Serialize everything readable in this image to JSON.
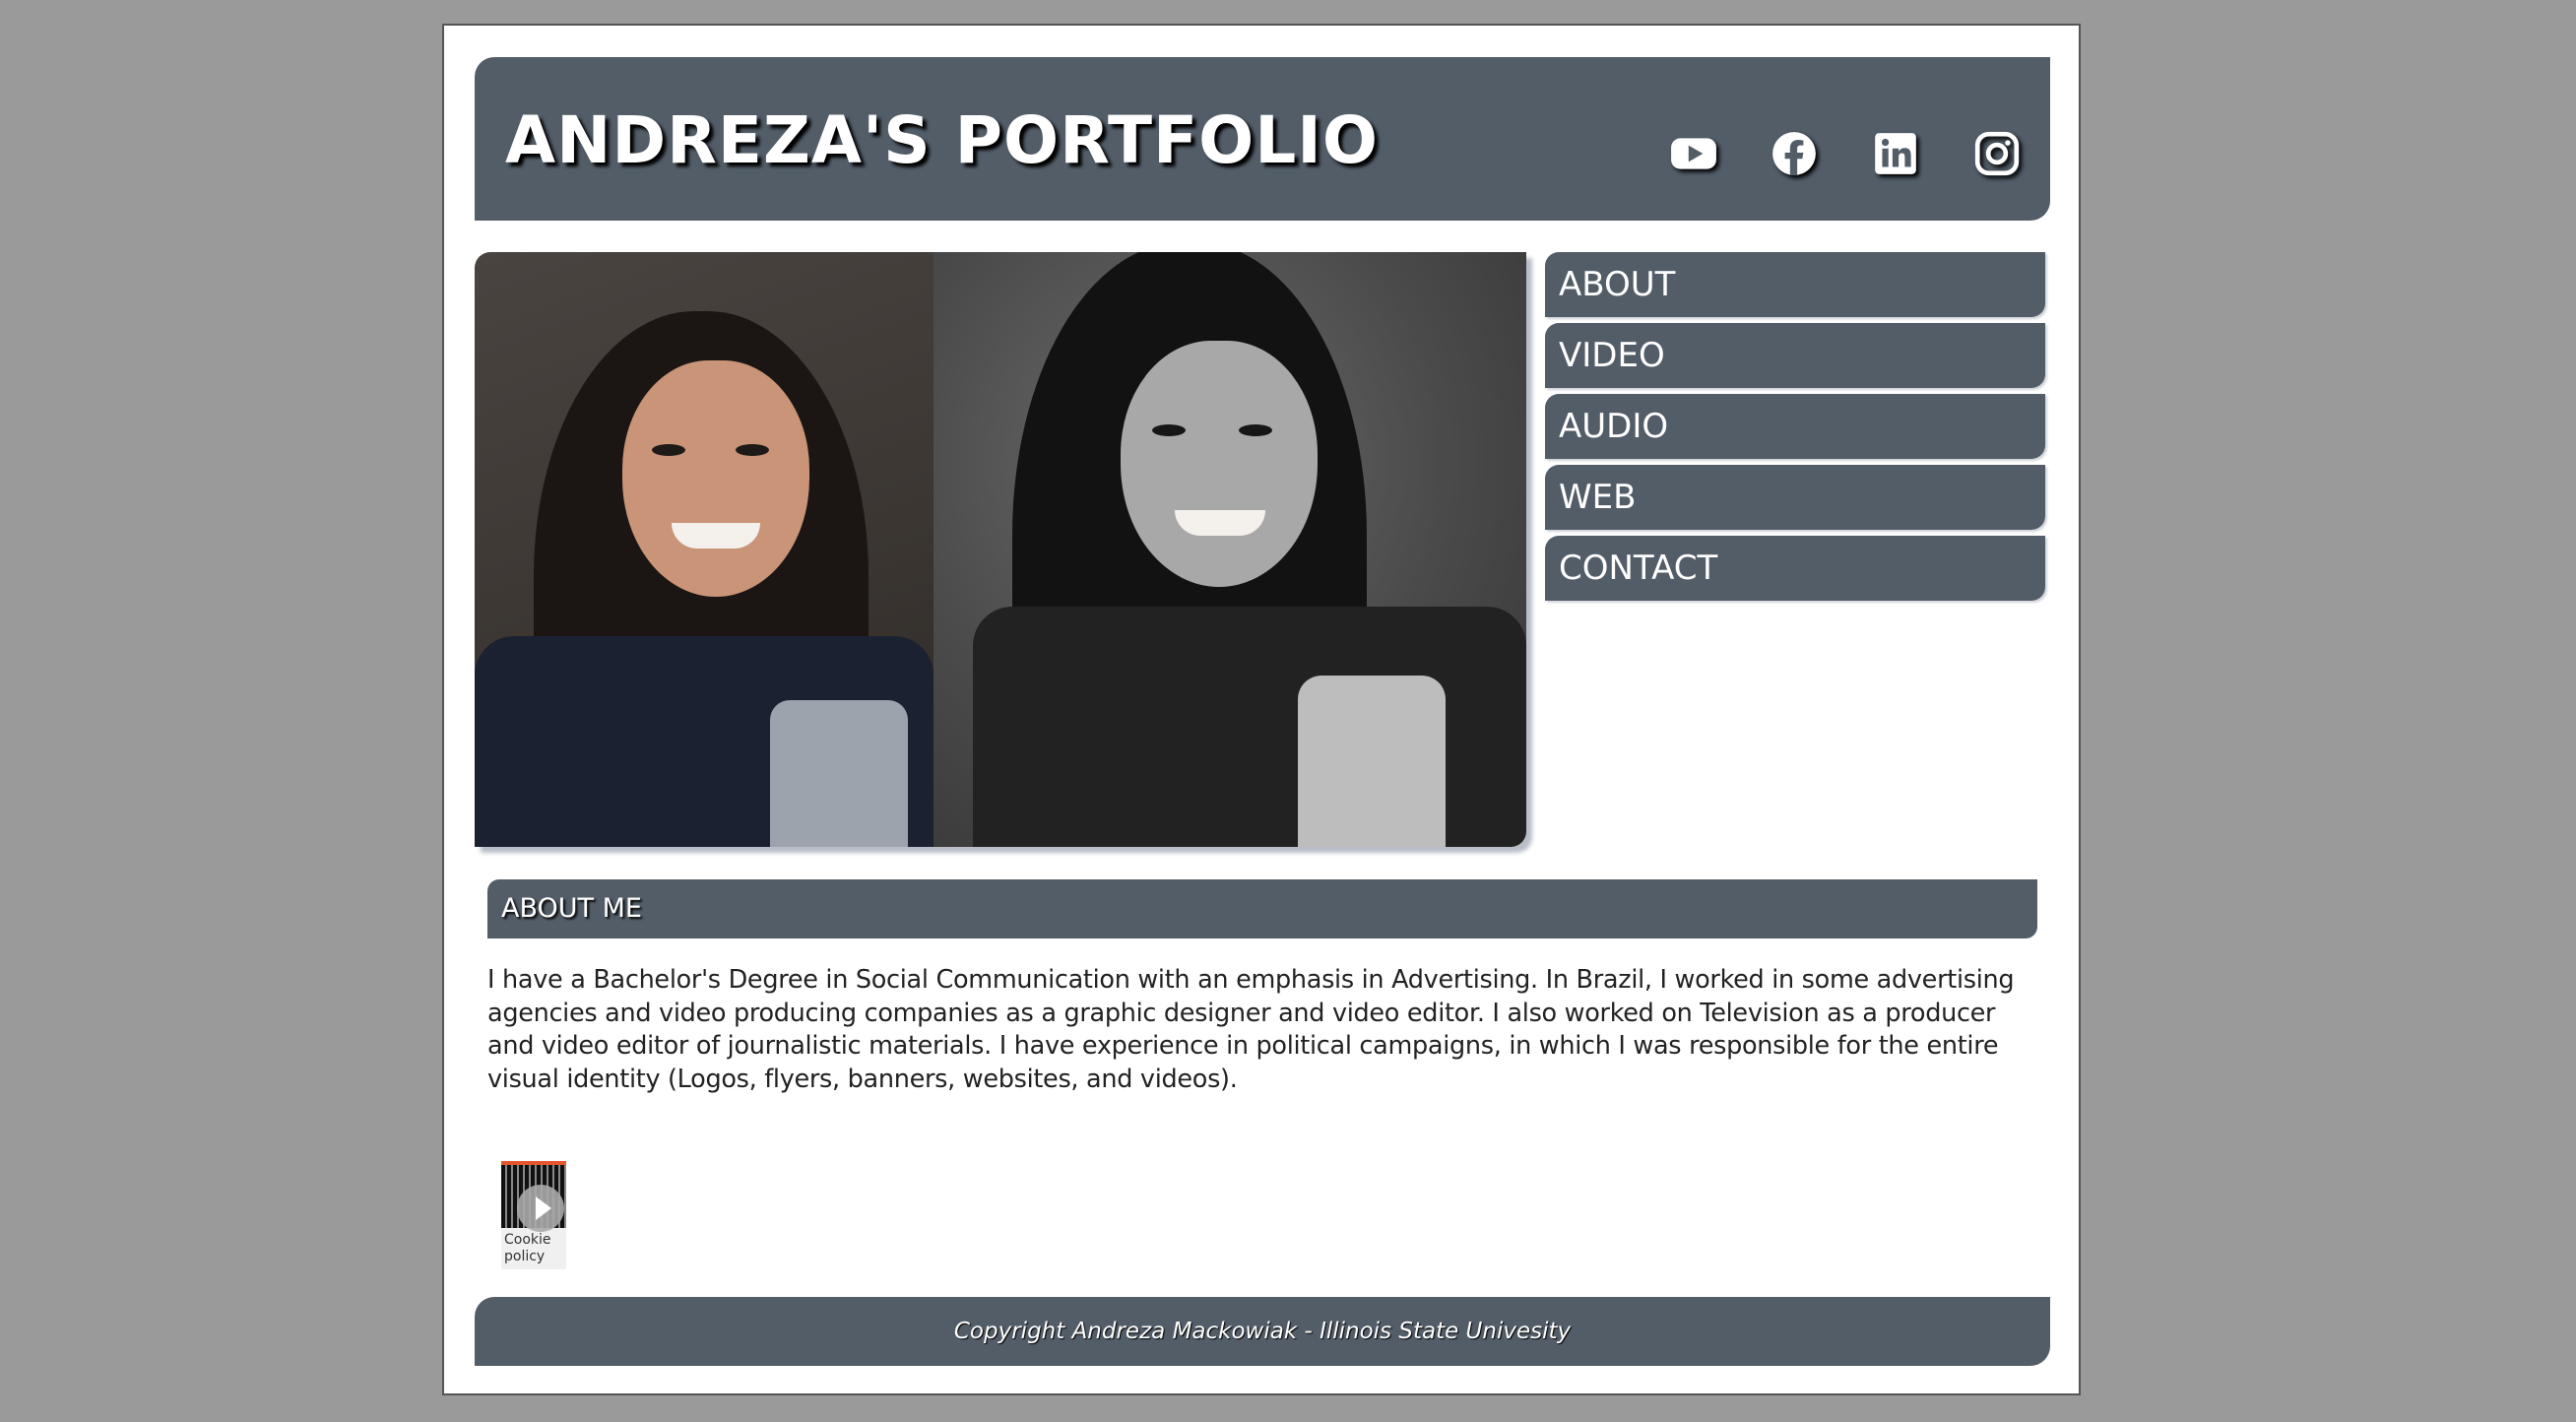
{
  "header": {
    "title": "ANDREZA'S PORTFOLIO",
    "social_icons": [
      "youtube-icon",
      "facebook-icon",
      "linkedin-icon",
      "instagram-icon"
    ]
  },
  "nav": {
    "items": [
      {
        "label": "ABOUT"
      },
      {
        "label": "VIDEO"
      },
      {
        "label": "AUDIO"
      },
      {
        "label": "WEB"
      },
      {
        "label": "CONTACT"
      }
    ]
  },
  "about": {
    "heading": "ABOUT ME",
    "body": "I have a Bachelor's Degree in Social Communication with an emphasis in Advertising. In Brazil, I worked in some advertising agencies and video producing companies as a graphic designer and video editor. I also worked on Television as a producer and video editor of journalistic materials. I have experience in political campaigns, in which I was responsible for the entire visual identity (Logos, flyers, banners, websites, and videos)."
  },
  "cookie_badge": {
    "label": "Cookie policy"
  },
  "footer": {
    "text": "Copyright Andreza Mackowiak - Illinois State Univesity"
  },
  "colors": {
    "background": "#9a9a9a",
    "panel": "#525d68",
    "page": "#ffffff",
    "text": "#222222"
  }
}
